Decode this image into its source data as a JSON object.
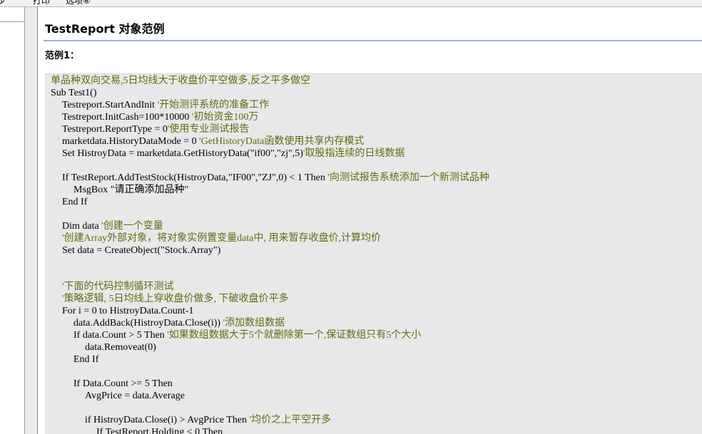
{
  "menubar": {
    "items": [
      "步",
      "打印",
      "选项⑥"
    ]
  },
  "page": {
    "title": "TestReport 对象范例",
    "section_heading": "范例1："
  },
  "code": {
    "lines": [
      {
        "indent": 0,
        "segs": [
          {
            "t": "单品种双向交易,5日均线大于收盘价平空做多,反之平多做空",
            "c": "comment"
          }
        ]
      },
      {
        "indent": 0,
        "segs": [
          {
            "t": "Sub Test1()",
            "c": "code"
          }
        ]
      },
      {
        "indent": 1,
        "segs": [
          {
            "t": "Testreport.StartAndInit ",
            "c": "code"
          },
          {
            "t": "'开始测评系统的准备工作",
            "c": "comment"
          }
        ]
      },
      {
        "indent": 1,
        "segs": [
          {
            "t": "Testreport.InitCash=100*10000 ",
            "c": "code"
          },
          {
            "t": "'初始资金100万",
            "c": "comment"
          }
        ]
      },
      {
        "indent": 1,
        "segs": [
          {
            "t": "Testreport.ReportType = 0",
            "c": "code"
          },
          {
            "t": "'使用专业测试报告",
            "c": "comment"
          }
        ]
      },
      {
        "indent": 1,
        "segs": [
          {
            "t": "marketdata.HistoryDataMode = 0 ",
            "c": "code"
          },
          {
            "t": "'GetHistoryData函数使用共享内存模式",
            "c": "comment"
          }
        ]
      },
      {
        "indent": 1,
        "segs": [
          {
            "t": "Set HistroyData = marketdata.GetHistoryData(\"if00\",\"zj\",5)",
            "c": "code"
          },
          {
            "t": "'取股指连续的日线数据",
            "c": "comment"
          }
        ]
      },
      {
        "indent": 0,
        "segs": []
      },
      {
        "indent": 1,
        "segs": [
          {
            "t": "If TestReport.AddTestStock(HistroyData,\"IF00\",\"ZJ\",0) < 1 Then ",
            "c": "code"
          },
          {
            "t": "'向测试报告系统添加一个新测试品种",
            "c": "comment"
          }
        ]
      },
      {
        "indent": 2,
        "segs": [
          {
            "t": "MsgBox \"请正确添加品种\"",
            "c": "code"
          }
        ]
      },
      {
        "indent": 1,
        "segs": [
          {
            "t": "End If",
            "c": "code"
          }
        ]
      },
      {
        "indent": 0,
        "segs": []
      },
      {
        "indent": 1,
        "segs": [
          {
            "t": "Dim data ",
            "c": "code"
          },
          {
            "t": "'创建一个变量",
            "c": "comment"
          }
        ]
      },
      {
        "indent": 1,
        "segs": [
          {
            "t": "'创建Array外部对象，将对象实例置变量data中, 用来暂存收盘价,计算均价",
            "c": "comment"
          }
        ]
      },
      {
        "indent": 1,
        "segs": [
          {
            "t": "Set data = CreateObject(\"Stock.Array\")",
            "c": "code"
          }
        ]
      },
      {
        "indent": 0,
        "segs": []
      },
      {
        "indent": 0,
        "segs": []
      },
      {
        "indent": 1,
        "segs": [
          {
            "t": "'下面的代码控制循环测试",
            "c": "comment"
          }
        ]
      },
      {
        "indent": 1,
        "segs": [
          {
            "t": "'策略逻辑, 5日均线上穿收盘价做多, 下破收盘价平多",
            "c": "comment"
          }
        ]
      },
      {
        "indent": 1,
        "segs": [
          {
            "t": "For i = 0 to HistroyData.Count-1",
            "c": "code"
          }
        ]
      },
      {
        "indent": 2,
        "segs": [
          {
            "t": "data.AddBack(HistroyData.Close(i)) ",
            "c": "code"
          },
          {
            "t": "'添加数组数据",
            "c": "comment"
          }
        ]
      },
      {
        "indent": 2,
        "segs": [
          {
            "t": "If data.Count > 5 Then ",
            "c": "code"
          },
          {
            "t": "'如果数组数据大于5个就删除第一个,保证数组只有5个大小",
            "c": "comment"
          }
        ]
      },
      {
        "indent": 3,
        "segs": [
          {
            "t": "data.Removeat(0)",
            "c": "code"
          }
        ]
      },
      {
        "indent": 2,
        "segs": [
          {
            "t": "End If",
            "c": "code"
          }
        ]
      },
      {
        "indent": 0,
        "segs": []
      },
      {
        "indent": 2,
        "segs": [
          {
            "t": "If Data.Count >= 5 Then",
            "c": "code"
          }
        ]
      },
      {
        "indent": 3,
        "segs": [
          {
            "t": "AvgPrice = data.Average",
            "c": "code"
          }
        ]
      },
      {
        "indent": 0,
        "segs": []
      },
      {
        "indent": 3,
        "segs": [
          {
            "t": "if HistroyData.Close(i) > AvgPrice Then ",
            "c": "code"
          },
          {
            "t": "'均价之上平空开多",
            "c": "comment"
          }
        ]
      },
      {
        "indent": 4,
        "segs": [
          {
            "t": "If TestReport.Holding < 0 Then",
            "c": "code"
          }
        ]
      }
    ]
  }
}
